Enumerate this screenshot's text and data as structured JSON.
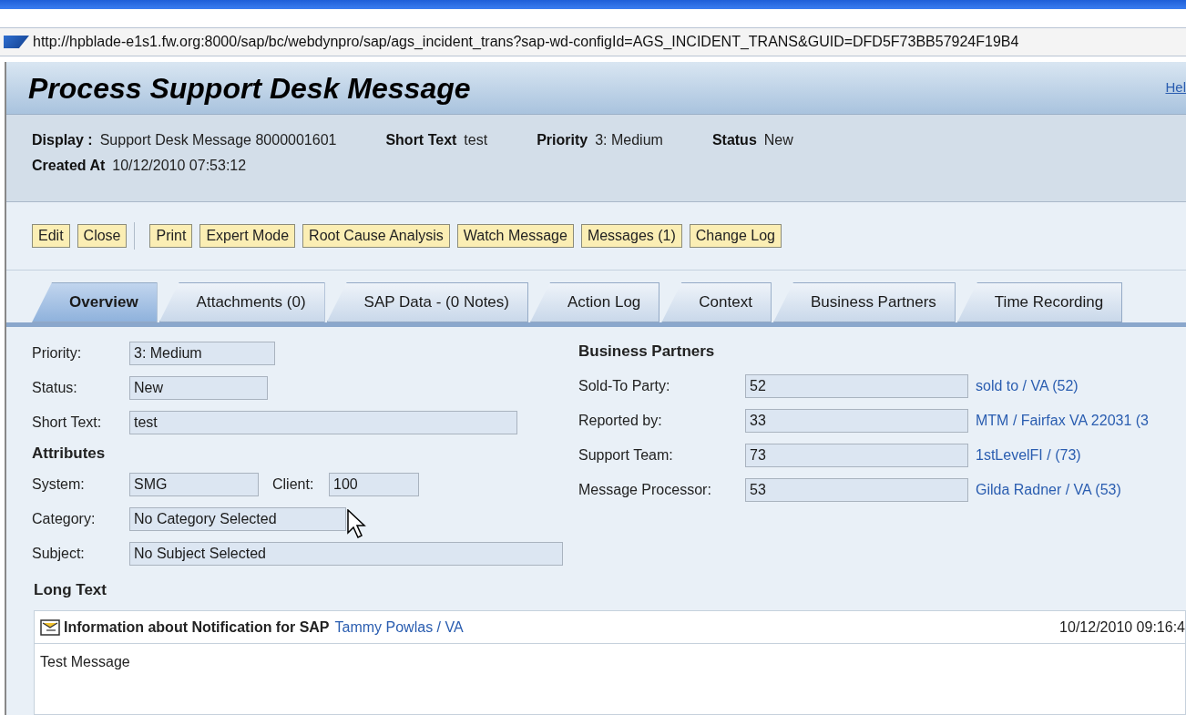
{
  "browser": {
    "address": "http://hpblade-e1s1.fw.org:8000/sap/bc/webdynpro/sap/ags_incident_trans?sap-wd-configId=AGS_INCIDENT_TRANS&GUID=DFD5F73BB57924F19B4"
  },
  "page": {
    "title": "Process Support Desk Message",
    "help_link": "Hel"
  },
  "header_rows": [
    [
      {
        "label": "Display :",
        "value": "Support Desk Message 8000001601"
      },
      {
        "label": "Short Text",
        "value": "test"
      },
      {
        "label": "Priority",
        "value": "3: Medium"
      },
      {
        "label": "Status",
        "value": "New"
      }
    ],
    [
      {
        "label": "Created At",
        "value": "10/12/2010 07:53:12"
      }
    ]
  ],
  "toolbar_groups": [
    [
      "Edit",
      "Close"
    ],
    [
      "Print",
      "Expert Mode",
      "Root Cause Analysis",
      "Watch Message",
      "Messages (1)",
      "Change Log"
    ]
  ],
  "tabs": [
    {
      "label": "Overview",
      "selected": true
    },
    {
      "label": "Attachments (0)",
      "selected": false
    },
    {
      "label": "SAP Data - (0 Notes)",
      "selected": false
    },
    {
      "label": "Action Log",
      "selected": false
    },
    {
      "label": "Context",
      "selected": false
    },
    {
      "label": "Business Partners",
      "selected": false
    },
    {
      "label": "Time Recording",
      "selected": false
    }
  ],
  "general_fields": [
    {
      "label": "Priority:",
      "value": "3: Medium"
    },
    {
      "label": "Status:",
      "value": "New"
    },
    {
      "label": "Short Text:",
      "value": "test"
    }
  ],
  "attributes": {
    "title": "Attributes",
    "system": {
      "label": "System:",
      "value": "SMG"
    },
    "client": {
      "label": "Client:",
      "value": "100"
    },
    "category": {
      "label": "Category:",
      "value": "No Category Selected"
    },
    "subject": {
      "label": "Subject:",
      "value": "No Subject Selected"
    }
  },
  "business_partners": {
    "title": "Business Partners",
    "rows": [
      {
        "label": "Sold-To Party:",
        "value": "52",
        "link": "sold to / VA (52)"
      },
      {
        "label": "Reported by:",
        "value": "33",
        "link": "MTM / Fairfax VA 22031 (3"
      },
      {
        "label": "Support Team:",
        "value": "73",
        "link": "1stLevelFI / (73)"
      },
      {
        "label": "Message Processor:",
        "value": "53",
        "link": "Gilda Radner / VA (53)"
      }
    ]
  },
  "long_text": {
    "title": "Long Text",
    "entries": [
      {
        "heading": "Information about Notification for SAP",
        "author": "Tammy Powlas / VA",
        "timestamp": "10/12/2010 09:16:4",
        "body": "Test Message"
      }
    ]
  }
}
